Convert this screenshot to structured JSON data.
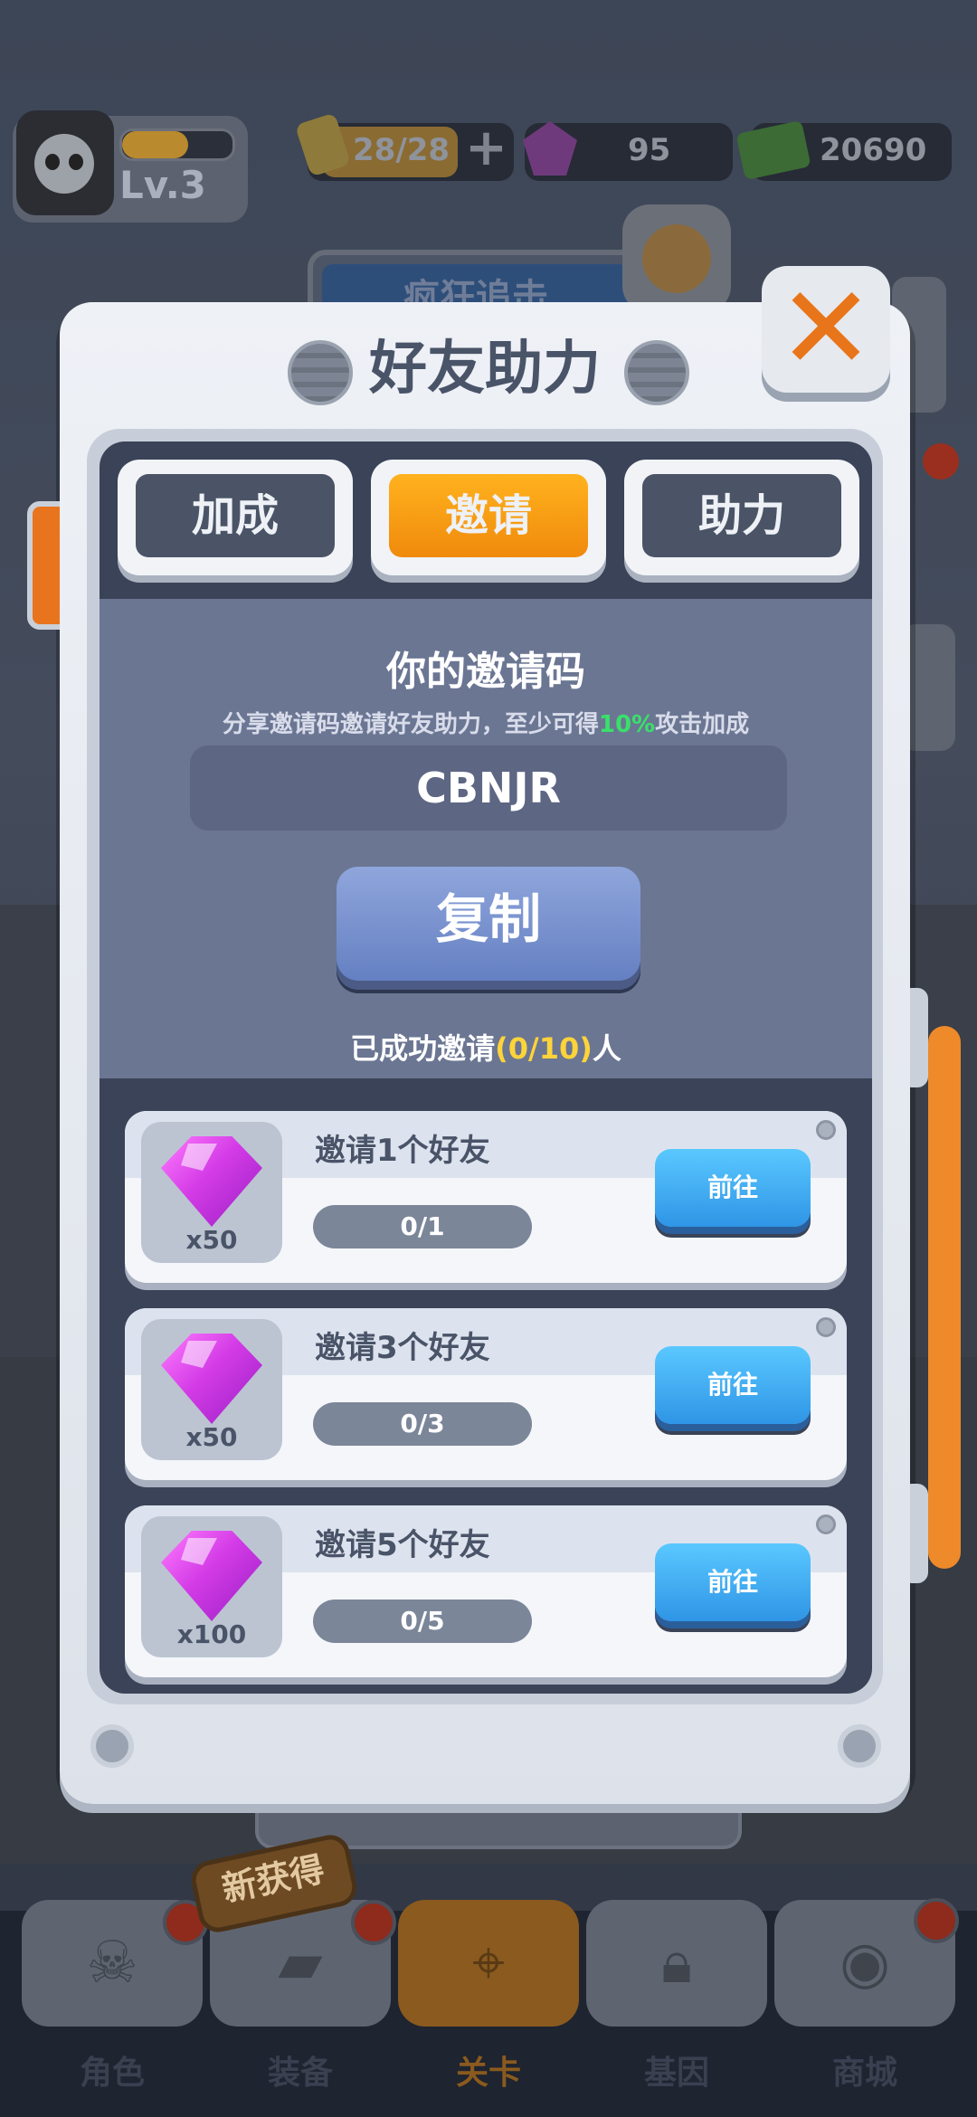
{
  "hud": {
    "level": "Lv.3",
    "xp_fraction": 0.6,
    "energy": "28/28",
    "gems": "95",
    "cash": "20690",
    "event_banner": "疯狂追击"
  },
  "modal": {
    "title": "好友助力",
    "tabs": [
      {
        "label": "加成",
        "active": false
      },
      {
        "label": "邀请",
        "active": true
      },
      {
        "label": "助力",
        "active": false
      }
    ],
    "invite": {
      "title": "你的邀请码",
      "desc_prefix": "分享邀请码邀请好友助力，至少可得",
      "desc_highlight": "10%",
      "desc_suffix": "攻击加成",
      "code": "CBNJR",
      "copy_label": "复制",
      "success_prefix": "已成功邀请",
      "success_count": "(0/10)",
      "success_suffix": "人"
    },
    "rewards": [
      {
        "task": "邀请1个好友",
        "qty": "x50",
        "progress": "0/1",
        "fraction": 0,
        "button": "前往"
      },
      {
        "task": "邀请3个好友",
        "qty": "x50",
        "progress": "0/3",
        "fraction": 0,
        "button": "前往"
      },
      {
        "task": "邀请5个好友",
        "qty": "x100",
        "progress": "0/5",
        "fraction": 0,
        "button": "前往"
      }
    ]
  },
  "nav": {
    "items": [
      {
        "label": "角色",
        "icon": "skull-icon"
      },
      {
        "label": "装备",
        "icon": "gun-icon"
      },
      {
        "label": "关卡",
        "icon": "map-pin-icon",
        "active": true
      },
      {
        "label": "基因",
        "icon": "lock-icon"
      },
      {
        "label": "商城",
        "icon": "shop-icon"
      }
    ],
    "new_tag": "新获得"
  },
  "colors": {
    "accent_orange": "#f08a0c",
    "go_button_blue": "#2f95e6",
    "highlight_green": "#39e06a",
    "highlight_yellow": "#ffd33a"
  }
}
